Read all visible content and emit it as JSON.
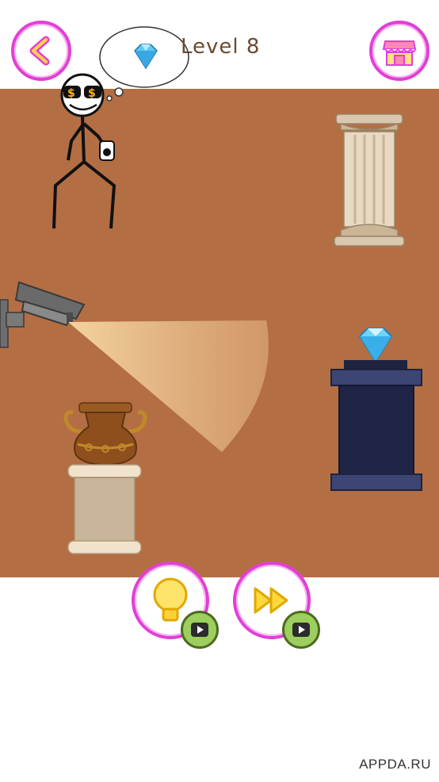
{
  "header": {
    "level_text": "Level 8",
    "back_icon": "chevron-left-icon",
    "shop_icon": "shop-icon",
    "thought_icon": "diamond-icon"
  },
  "scene": {
    "background_color": "#b46e43",
    "objects": [
      "thief-stickman",
      "greek-column",
      "security-camera",
      "vase-on-pedestal",
      "diamond-on-pedestal"
    ]
  },
  "controls": {
    "hint_icon": "lightbulb-icon",
    "skip_icon": "fast-forward-icon",
    "video_badge_icon": "play-video-icon"
  },
  "colors": {
    "accent_pink": "#e23fd6",
    "badge_green": "#9ccf5e",
    "text_brown": "#6b4a2f"
  },
  "watermark": "APPDA.RU"
}
